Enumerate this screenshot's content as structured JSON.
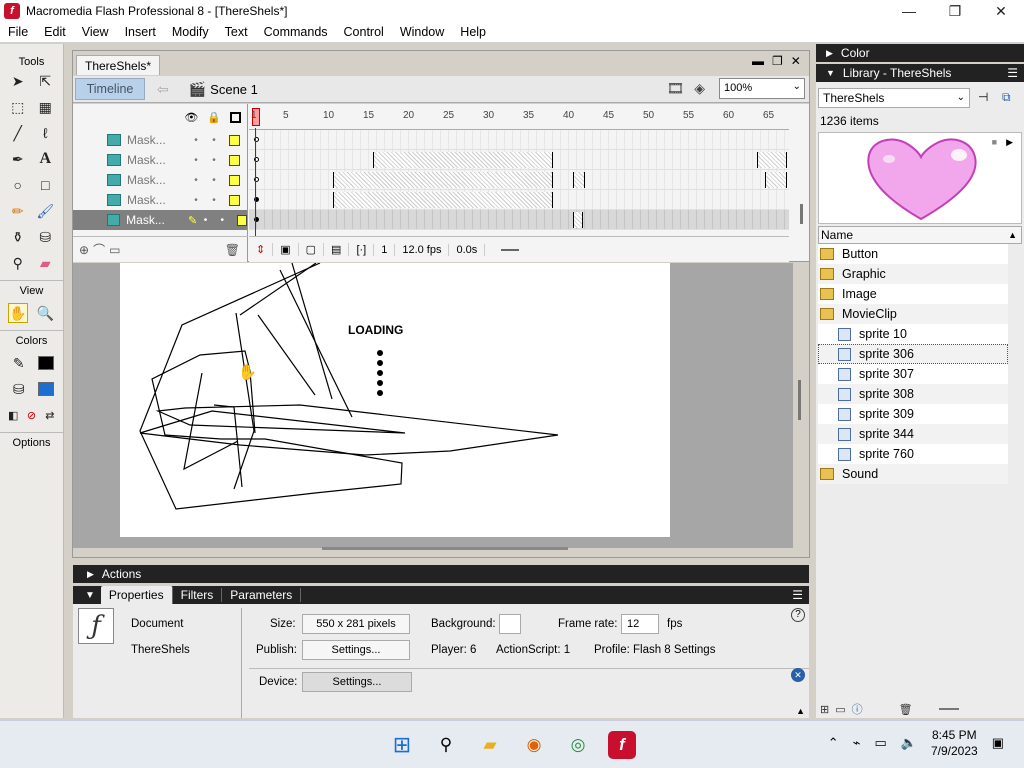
{
  "window": {
    "title": "Macromedia Flash Professional 8 - [ThereShels*]",
    "controls": [
      "—",
      "❐",
      "✕"
    ]
  },
  "menu": [
    "File",
    "Edit",
    "View",
    "Insert",
    "Modify",
    "Text",
    "Commands",
    "Control",
    "Window",
    "Help"
  ],
  "tools": {
    "header": "Tools",
    "view_label": "View",
    "colors_label": "Colors",
    "options_label": "Options"
  },
  "document": {
    "tab": "ThereShels*",
    "timeline_button": "Timeline",
    "scene": "Scene 1",
    "zoom": "100%"
  },
  "timeline": {
    "ruler": [
      "1",
      "5",
      "10",
      "15",
      "20",
      "25",
      "30",
      "35",
      "40",
      "45",
      "50",
      "55",
      "60",
      "65"
    ],
    "layers": [
      {
        "name": "Mask..."
      },
      {
        "name": "Mask..."
      },
      {
        "name": "Mask..."
      },
      {
        "name": "Mask..."
      },
      {
        "name": "Mask..."
      }
    ],
    "footer": {
      "current_frame": "1",
      "fps": "12.0 fps",
      "time": "0.0s"
    }
  },
  "stage": {
    "loading_text": "LOADING"
  },
  "panels": {
    "actions": "Actions",
    "tabs": [
      "Properties",
      "Filters",
      "Parameters"
    ]
  },
  "properties": {
    "type": "Document",
    "name": "ThereShels",
    "size_label": "Size:",
    "size_value": "550 x 281 pixels",
    "background_label": "Background:",
    "frame_rate_label": "Frame rate:",
    "frame_rate_value": "12",
    "fps_unit": "fps",
    "publish_label": "Publish:",
    "settings_button": "Settings...",
    "player": "Player: 6",
    "actionscript": "ActionScript: 1",
    "profile": "Profile: Flash 8 Settings",
    "device_label": "Device:",
    "device_settings_button": "Settings..."
  },
  "right": {
    "color_panel": "Color",
    "library_panel": "Library - ThereShels",
    "library_select": "ThereShels",
    "item_count": "1236 items",
    "name_header": "Name",
    "items": [
      {
        "label": "Button",
        "type": "folder"
      },
      {
        "label": "Graphic",
        "type": "folder"
      },
      {
        "label": "Image",
        "type": "folder"
      },
      {
        "label": "MovieClip",
        "type": "folder-open"
      },
      {
        "label": "sprite 10",
        "type": "movieclip"
      },
      {
        "label": "sprite 306",
        "type": "movieclip",
        "selected": true
      },
      {
        "label": "sprite 307",
        "type": "movieclip"
      },
      {
        "label": "sprite 308",
        "type": "movieclip"
      },
      {
        "label": "sprite 309",
        "type": "movieclip"
      },
      {
        "label": "sprite 344",
        "type": "movieclip"
      },
      {
        "label": "sprite 760",
        "type": "movieclip"
      },
      {
        "label": "Sound",
        "type": "folder"
      }
    ]
  },
  "taskbar": {
    "time": "8:45 PM",
    "date": "7/9/2023"
  },
  "colors": {
    "timeline_button_bg": "#b9d0ea",
    "heart_fill": "#f2a6ec",
    "heart_stroke": "#c23fb8",
    "panel_header_bg": "#222222"
  }
}
